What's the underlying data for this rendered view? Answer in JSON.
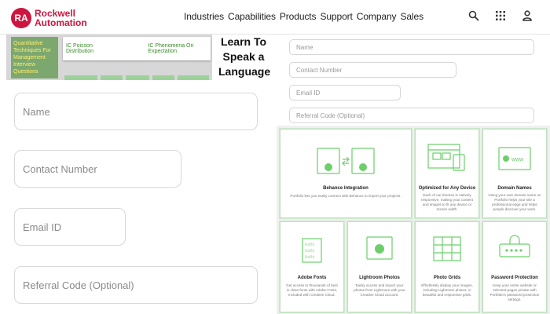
{
  "brand": {
    "badge": "RA",
    "line1": "Rockwell",
    "line2": "Automation",
    "color": "#cd163f"
  },
  "nav": [
    "Industries",
    "Capabilities",
    "Products",
    "Support",
    "Company",
    "Sales"
  ],
  "header_icons": [
    "search-icon",
    "apps-grid-icon",
    "user-icon"
  ],
  "collage": {
    "thumb_text": "Quantitative Techniques For Management Interview Questions",
    "card_items": [
      "IC Poisson Distribution",
      "IC Phenomena On Expectation"
    ],
    "lang_title": "Learn To Speak a Language"
  },
  "form_large": {
    "name_placeholder": "Name",
    "contact_placeholder": "Contact Number",
    "email_placeholder": "Email ID",
    "referral_placeholder": "Referral Code (Optional)"
  },
  "form_small": {
    "name_placeholder": "Name",
    "contact_placeholder": "Contact Number",
    "email_placeholder": "Email ID",
    "referral_placeholder": "Referral Code (Optional)"
  },
  "features": [
    {
      "title": "Behance Integration",
      "desc": "Portfolio lets you easily connect with Behance to import your projects.",
      "icon": "behance-integration-icon"
    },
    {
      "title": "Optimized for Any Device",
      "desc": "Each of our themes is natively responsive, making your content and images to fit any device or screen width.",
      "icon": "devices-icon"
    },
    {
      "title": "Domain Names",
      "desc": "Using your own domain name on Portfolio helps your site a professional edge and helps people discover your work.",
      "icon": "domain-icon"
    },
    {
      "title": "Adobe Fonts",
      "desc": "Get access to thousands of best in class fonts with Adobe Fonts, included with Creative Cloud.",
      "icon": "fonts-icon"
    },
    {
      "title": "Lightroom Photos",
      "desc": "Easily access and import your photos from Lightroom with your Creative Cloud account.",
      "icon": "lightroom-icon"
    },
    {
      "title": "Photo Grids",
      "desc": "Effortlessly display your images, including Lightroom photos, in beautiful and responsive grids.",
      "icon": "photo-grid-icon"
    },
    {
      "title": "Password Protection",
      "desc": "Keep your entire website or selected pages private with Portfolio's password protection settings.",
      "icon": "password-icon"
    }
  ]
}
